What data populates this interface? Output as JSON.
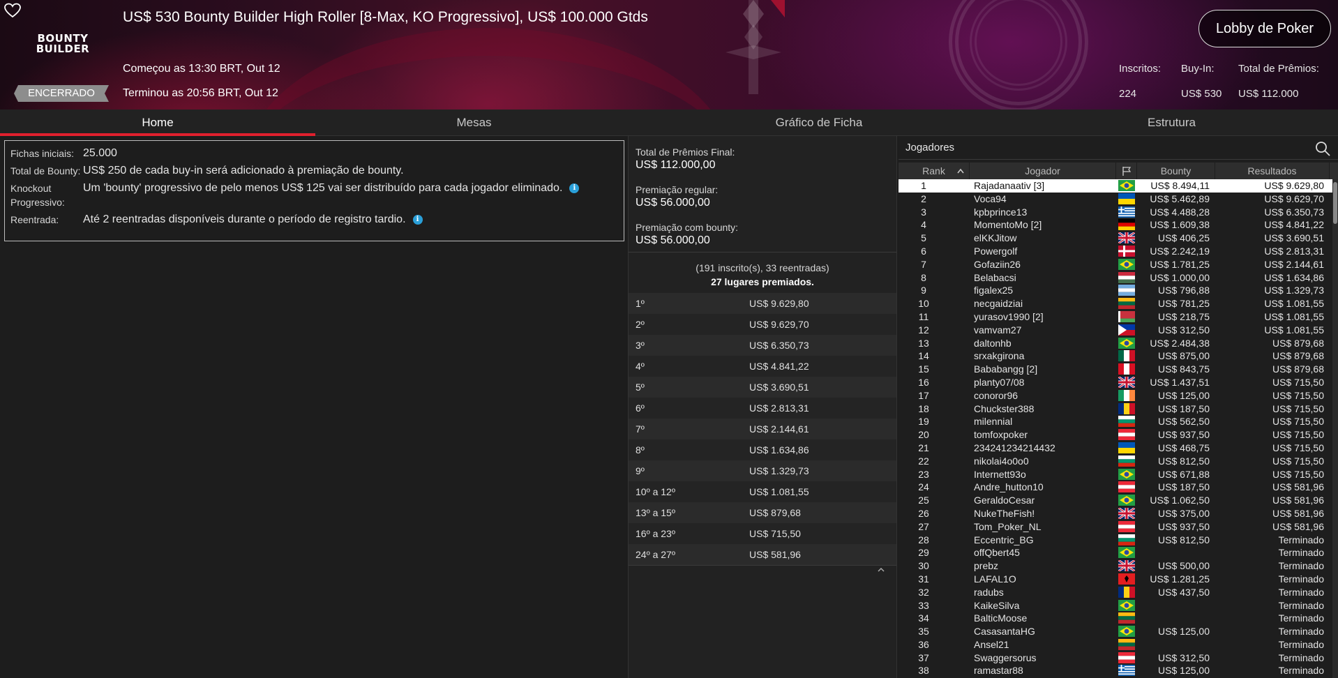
{
  "header": {
    "title": "US$ 530 Bounty Builder High Roller [8-Max, KO Progressivo], US$ 100.000 Gtds",
    "logo_line1": "BOUNTY",
    "logo_line2": "BUILDER",
    "status": "ENCERRADO",
    "started": "Começou as 13:30 BRT, Out 12",
    "ended": "Terminou as 20:56 BRT, Out 12",
    "lobby_button": "Lobby de Poker",
    "entrants_label": "Inscritos:",
    "entrants_value": "224",
    "buyin_label": "Buy-In:",
    "buyin_value": "US$ 530",
    "prize_label": "Total de Prêmios:",
    "prize_value": "US$ 112.000"
  },
  "tabs": [
    "Home",
    "Mesas",
    "Gráfico de Ficha",
    "Estrutura"
  ],
  "info": [
    {
      "label": "Fichas iniciais:",
      "value": "25.000",
      "info": false
    },
    {
      "label": "Total de Bounty:",
      "value": "US$ 250 de cada buy-in será adicionado à premiação de bounty.",
      "info": false
    },
    {
      "label": "Knockout Progressivo:",
      "value": "Um 'bounty' progressivo de pelo menos US$ 125 vai ser distribuído para cada jogador eliminado.",
      "info": true
    },
    {
      "label": "Reentrada:",
      "value": "Até 2 reentradas disponíveis durante o período de registro tardio.",
      "info": true
    }
  ],
  "prize_pool": {
    "final_label": "Total de Prêmios Final:",
    "final_value": "US$ 112.000,00",
    "regular_label": "Premiação regular:",
    "regular_value": "US$ 56.000,00",
    "bounty_label": "Premiação com bounty:",
    "bounty_value": "US$ 56.000,00",
    "summary_line1": "(191 inscrito(s), 33 reentradas)",
    "summary_line2": "27 lugares premiados."
  },
  "payouts": [
    {
      "pos": "1º",
      "amount": "US$ 9.629,80"
    },
    {
      "pos": "2º",
      "amount": "US$ 9.629,70"
    },
    {
      "pos": "3º",
      "amount": "US$ 6.350,73"
    },
    {
      "pos": "4º",
      "amount": "US$ 4.841,22"
    },
    {
      "pos": "5º",
      "amount": "US$ 3.690,51"
    },
    {
      "pos": "6º",
      "amount": "US$ 2.813,31"
    },
    {
      "pos": "7º",
      "amount": "US$ 2.144,61"
    },
    {
      "pos": "8º",
      "amount": "US$ 1.634,86"
    },
    {
      "pos": "9º",
      "amount": "US$ 1.329,73"
    },
    {
      "pos": "10º a 12º",
      "amount": "US$ 1.081,55"
    },
    {
      "pos": "13º a 15º",
      "amount": "US$ 879,68"
    },
    {
      "pos": "16º a 23º",
      "amount": "US$ 715,50"
    },
    {
      "pos": "24º a 27º",
      "amount": "US$ 581,96"
    }
  ],
  "players": {
    "title": "Jogadores",
    "columns": {
      "rank": "Rank",
      "name": "Jogador",
      "bounty": "Bounty",
      "result": "Resultados"
    },
    "rows": [
      {
        "rank": "1",
        "name": "Rajadanaativ [3]",
        "flag": "br",
        "bounty": "US$ 8.494,11",
        "result": "US$ 9.629,80"
      },
      {
        "rank": "2",
        "name": "Voca94",
        "flag": "ua",
        "bounty": "US$ 5.462,89",
        "result": "US$ 9.629,70"
      },
      {
        "rank": "3",
        "name": "kpbprince13",
        "flag": "gr",
        "bounty": "US$ 4.488,28",
        "result": "US$ 6.350,73"
      },
      {
        "rank": "4",
        "name": "MomentoMo [2]",
        "flag": "de",
        "bounty": "US$ 1.609,38",
        "result": "US$ 4.841,22"
      },
      {
        "rank": "5",
        "name": "elKKJitow",
        "flag": "gb",
        "bounty": "US$ 406,25",
        "result": "US$ 3.690,51"
      },
      {
        "rank": "6",
        "name": "Powergolf",
        "flag": "dk",
        "bounty": "US$ 2.242,19",
        "result": "US$ 2.813,31"
      },
      {
        "rank": "7",
        "name": "Gofaziin26",
        "flag": "br",
        "bounty": "US$ 1.781,25",
        "result": "US$ 2.144,61"
      },
      {
        "rank": "8",
        "name": "Belabacsi",
        "flag": "hu",
        "bounty": "US$ 1.000,00",
        "result": "US$ 1.634,86"
      },
      {
        "rank": "9",
        "name": "figalex25",
        "flag": "ar",
        "bounty": "US$ 796,88",
        "result": "US$ 1.329,73"
      },
      {
        "rank": "10",
        "name": "necgaidziai",
        "flag": "lt",
        "bounty": "US$ 781,25",
        "result": "US$ 1.081,55"
      },
      {
        "rank": "11",
        "name": "yurasov1990 [2]",
        "flag": "by",
        "bounty": "US$ 218,75",
        "result": "US$ 1.081,55"
      },
      {
        "rank": "12",
        "name": "vamvam27",
        "flag": "ph",
        "bounty": "US$ 312,50",
        "result": "US$ 1.081,55"
      },
      {
        "rank": "13",
        "name": "daltonhb",
        "flag": "br",
        "bounty": "US$ 2.484,38",
        "result": "US$ 879,68"
      },
      {
        "rank": "14",
        "name": "srxakgirona",
        "flag": "mx",
        "bounty": "US$ 875,00",
        "result": "US$ 879,68"
      },
      {
        "rank": "15",
        "name": "Bababangg [2]",
        "flag": "pe",
        "bounty": "US$ 843,75",
        "result": "US$ 879,68"
      },
      {
        "rank": "16",
        "name": "planty07/08",
        "flag": "gb",
        "bounty": "US$ 1.437,51",
        "result": "US$ 715,50"
      },
      {
        "rank": "17",
        "name": "conoror96",
        "flag": "ie",
        "bounty": "US$ 125,00",
        "result": "US$ 715,50"
      },
      {
        "rank": "18",
        "name": "Chuckster388",
        "flag": "ro",
        "bounty": "US$ 187,50",
        "result": "US$ 715,50"
      },
      {
        "rank": "19",
        "name": "milennial",
        "flag": "bg",
        "bounty": "US$ 562,50",
        "result": "US$ 715,50"
      },
      {
        "rank": "20",
        "name": "tomfoxpoker",
        "flag": "at",
        "bounty": "US$ 937,50",
        "result": "US$ 715,50"
      },
      {
        "rank": "21",
        "name": "234241234214432",
        "flag": "ua",
        "bounty": "US$ 468,75",
        "result": "US$ 715,50"
      },
      {
        "rank": "22",
        "name": "nikolai4o0o0",
        "flag": "bg",
        "bounty": "US$ 812,50",
        "result": "US$ 715,50"
      },
      {
        "rank": "23",
        "name": "Internett93o",
        "flag": "br",
        "bounty": "US$ 671,88",
        "result": "US$ 715,50"
      },
      {
        "rank": "24",
        "name": "Andre_hutton10",
        "flag": "at",
        "bounty": "US$ 187,50",
        "result": "US$ 581,96"
      },
      {
        "rank": "25",
        "name": "GeraldoCesar",
        "flag": "br",
        "bounty": "US$ 1.062,50",
        "result": "US$ 581,96"
      },
      {
        "rank": "26",
        "name": "NukeTheFish!",
        "flag": "gb",
        "bounty": "US$ 375,00",
        "result": "US$ 581,96"
      },
      {
        "rank": "27",
        "name": "Tom_Poker_NL",
        "flag": "at",
        "bounty": "US$ 937,50",
        "result": "US$ 581,96"
      },
      {
        "rank": "28",
        "name": "Eccentric_BG",
        "flag": "bg",
        "bounty": "US$ 812,50",
        "result": "Terminado"
      },
      {
        "rank": "29",
        "name": "offQbert45",
        "flag": "br",
        "bounty": "",
        "result": "Terminado"
      },
      {
        "rank": "30",
        "name": "prebz",
        "flag": "gb",
        "bounty": "US$ 500,00",
        "result": "Terminado"
      },
      {
        "rank": "31",
        "name": "LAFAL1O",
        "flag": "al",
        "bounty": "US$ 1.281,25",
        "result": "Terminado"
      },
      {
        "rank": "32",
        "name": "radubs",
        "flag": "ro",
        "bounty": "US$ 437,50",
        "result": "Terminado"
      },
      {
        "rank": "33",
        "name": "KaikeSilva",
        "flag": "br",
        "bounty": "",
        "result": "Terminado"
      },
      {
        "rank": "34",
        "name": "BalticMoose",
        "flag": "lt",
        "bounty": "",
        "result": "Terminado"
      },
      {
        "rank": "35",
        "name": "CasasantaHG",
        "flag": "br",
        "bounty": "US$ 125,00",
        "result": "Terminado"
      },
      {
        "rank": "36",
        "name": "Ansel21",
        "flag": "lt",
        "bounty": "",
        "result": "Terminado"
      },
      {
        "rank": "37",
        "name": "Swaggersorus",
        "flag": "at",
        "bounty": "US$ 312,50",
        "result": "Terminado"
      },
      {
        "rank": "38",
        "name": "ramastar88",
        "flag": "gr",
        "bounty": "US$ 125,00",
        "result": "Terminado"
      }
    ]
  },
  "icons": {
    "favorite": "heart-icon",
    "info": "info-icon",
    "search": "search-icon",
    "sort": "chevron-up-icon",
    "country": "flag-icon",
    "collapse": "chevron-up-icon"
  },
  "colors": {
    "accent": "#e0202e",
    "info": "#2a9fd8",
    "status_badge": "#8d8d8d"
  }
}
